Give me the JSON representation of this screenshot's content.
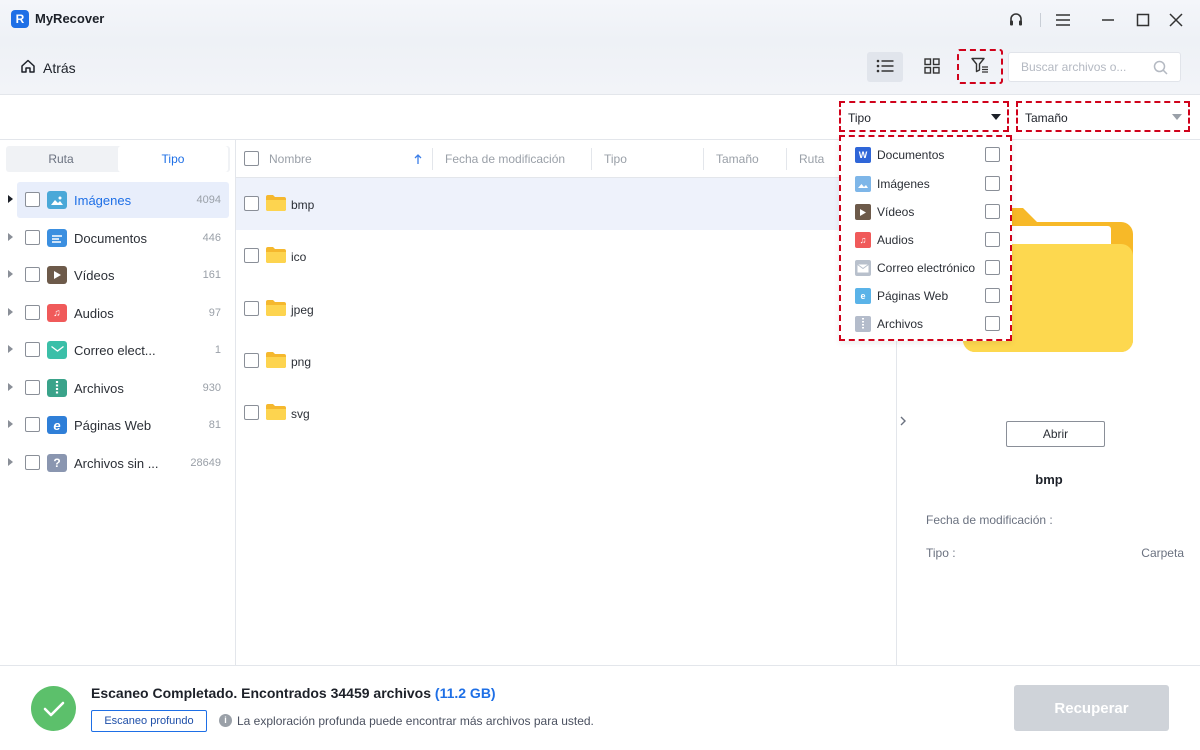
{
  "app": {
    "title": "MyRecover"
  },
  "toolbar": {
    "back_label": "Atrás",
    "search_placeholder": "Buscar archivos o..."
  },
  "filters": {
    "type_label": "Tipo",
    "size_label": "Tamaño"
  },
  "type_dropdown": {
    "items": [
      {
        "label": "Documentos",
        "icon": "word-doc-icon",
        "color": "#2f66d8"
      },
      {
        "label": "Imágenes",
        "icon": "image-icon",
        "color": "#7eb6e8"
      },
      {
        "label": "Vídeos",
        "icon": "video-icon",
        "color": "#6d5a4a"
      },
      {
        "label": "Audios",
        "icon": "music-icon",
        "color": "#f05a5a"
      },
      {
        "label": "Correo electrónico",
        "icon": "mail-icon",
        "color": "#b8c0cc"
      },
      {
        "label": "Páginas Web",
        "icon": "web-page-icon",
        "color": "#5ab3e8"
      },
      {
        "label": "Archivos",
        "icon": "archive-icon",
        "color": "#b4bccb"
      }
    ]
  },
  "sidebar": {
    "tabs": [
      "Ruta",
      "Tipo"
    ],
    "active_tab": "Tipo",
    "items": [
      {
        "label": "Imágenes",
        "count": "4094",
        "icon": "image-icon",
        "color": "#4aa8d8"
      },
      {
        "label": "Documentos",
        "count": "446",
        "icon": "document-icon",
        "color": "#3b8fe0"
      },
      {
        "label": "Vídeos",
        "count": "161",
        "icon": "video-icon",
        "color": "#6d5a4a"
      },
      {
        "label": "Audios",
        "count": "97",
        "icon": "music-icon",
        "color": "#f05a5a"
      },
      {
        "label": "Correo elect...",
        "count": "1",
        "icon": "mail-icon",
        "color": "#3bbfa8"
      },
      {
        "label": "Archivos",
        "count": "930",
        "icon": "archive-icon",
        "color": "#3aa38a"
      },
      {
        "label": "Páginas Web",
        "count": "81",
        "icon": "web-page-icon",
        "color": "#2f7fd8"
      },
      {
        "label": "Archivos sin ...",
        "count": "28649",
        "icon": "unknown-file-icon",
        "color": "#8a96b0"
      }
    ]
  },
  "file_list": {
    "columns": [
      "Nombre",
      "Fecha de modificación",
      "Tipo",
      "Tamaño",
      "Ruta"
    ],
    "rows": [
      {
        "name": "bmp"
      },
      {
        "name": "ico"
      },
      {
        "name": "jpeg"
      },
      {
        "name": "png"
      },
      {
        "name": "svg"
      }
    ]
  },
  "preview": {
    "open_label": "Abrir",
    "name": "bmp",
    "modified_label": "Fecha de modificación :",
    "modified_value": "",
    "type_label": "Tipo :",
    "type_value": "Carpeta"
  },
  "footer": {
    "status_text": "Escaneo Completado. Encontrados 34459 archivos",
    "status_size": "(11.2 GB)",
    "deep_scan_label": "Escaneo profundo",
    "info_text": "La exploración profunda puede encontrar más archivos para usted.",
    "recover_label": "Recuperar"
  },
  "colors": {
    "accent": "#1e6fe6",
    "success": "#5cc06b",
    "highlight": "#d0021b",
    "folder": "#fbc934"
  }
}
